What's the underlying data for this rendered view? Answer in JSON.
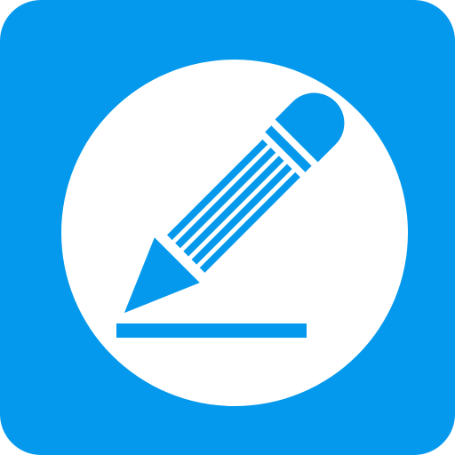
{
  "icon": {
    "name": "edit-pencil-app-icon",
    "glyph": "pencil-icon",
    "colors": {
      "tile": "#0499EC",
      "circle": "#FFFFFF",
      "pencil": "#0499EC"
    }
  }
}
